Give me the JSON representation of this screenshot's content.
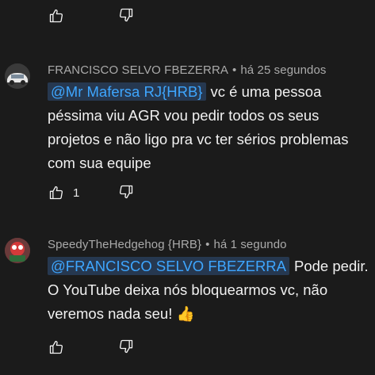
{
  "colors": {
    "background": "#1b1b1b",
    "text": "#f1f1f1",
    "meta": "#aaaaaa",
    "mention": "#3ea6ff"
  },
  "top_actions": {
    "like_icon": "thumbs-up-icon",
    "dislike_icon": "thumbs-down-icon"
  },
  "comments": [
    {
      "author": "FRANCISCO SELVO FBEZERRA",
      "separator": "•",
      "time": "há 25 segundos",
      "mention": "@Mr Mafersa RJ{HRB}",
      "text": "vc é uma pessoa péssima viu AGR vou pedir todos os seus projetos e não ligo pra vc ter sérios problemas com sua equipe",
      "likes": "1"
    },
    {
      "author": "SpeedyTheHedgehog {HRB}",
      "separator": "•",
      "time": "há 1 segundo",
      "mention": "@FRANCISCO SELVO FBEZERRA",
      "text": "Pode pedir. O YouTube deixa nós bloquearmos vc, não veremos nada seu!",
      "emoji": "👍",
      "likes": ""
    }
  ]
}
